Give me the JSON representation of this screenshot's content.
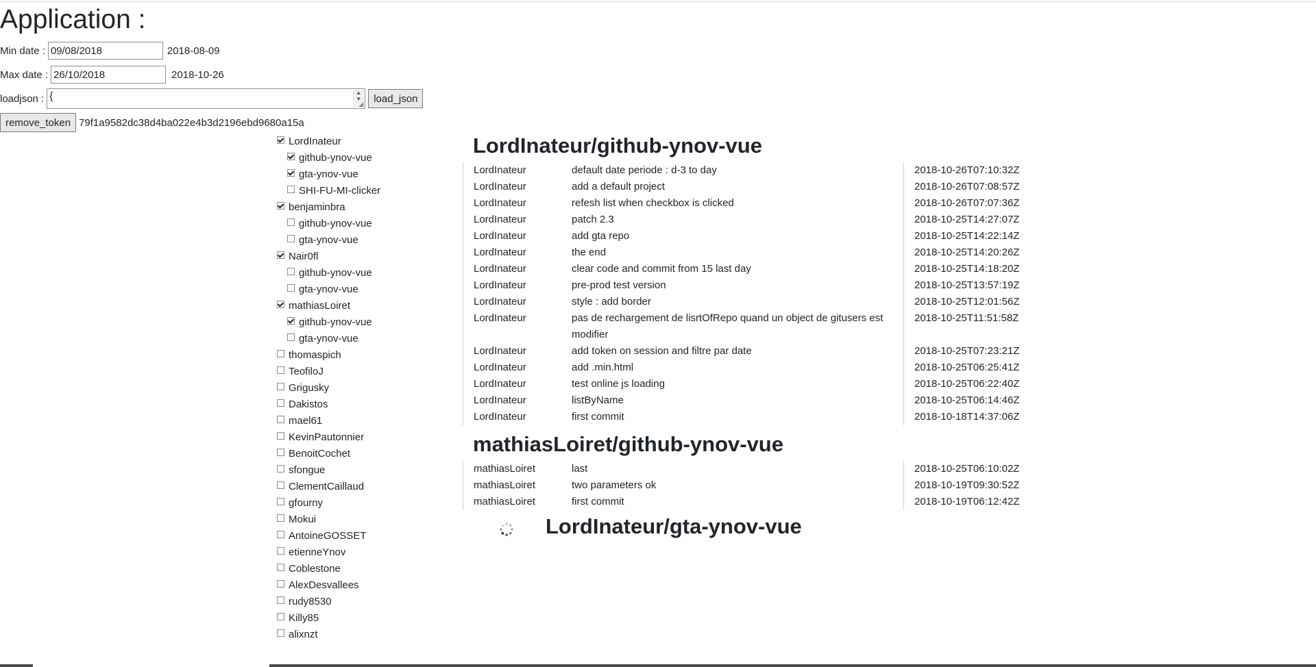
{
  "title": "Application :",
  "filters": {
    "min_label": "Min date :",
    "min_value": "09/08/2018",
    "min_iso": "2018-08-09",
    "max_label": "Max date :",
    "max_value": "26/10/2018",
    "max_iso": "2018-10-26",
    "json_label": "loadjson :",
    "json_value": "{",
    "load_button": "load_json",
    "remove_button": "remove_token",
    "token": "79f1a9582dc38d4ba022e4b3d2196ebd9680a15a"
  },
  "users": [
    {
      "name": "LordInateur",
      "checked": true,
      "repos": [
        {
          "name": "github-ynov-vue",
          "checked": true
        },
        {
          "name": "gta-ynov-vue",
          "checked": true
        },
        {
          "name": "SHI-FU-MI-clicker",
          "checked": false
        }
      ]
    },
    {
      "name": "benjaminbra",
      "checked": true,
      "repos": [
        {
          "name": "github-ynov-vue",
          "checked": false
        },
        {
          "name": "gta-ynov-vue",
          "checked": false
        }
      ]
    },
    {
      "name": "Nair0fl",
      "checked": true,
      "repos": [
        {
          "name": "github-ynov-vue",
          "checked": false
        },
        {
          "name": "gta-ynov-vue",
          "checked": false
        }
      ]
    },
    {
      "name": "mathiasLoiret",
      "checked": true,
      "repos": [
        {
          "name": "github-ynov-vue",
          "checked": true
        },
        {
          "name": "gta-ynov-vue",
          "checked": false
        }
      ]
    },
    {
      "name": "thomaspich",
      "checked": false,
      "repos": []
    },
    {
      "name": "TeofiloJ",
      "checked": false,
      "repos": []
    },
    {
      "name": "Grigusky",
      "checked": false,
      "repos": []
    },
    {
      "name": "Dakistos",
      "checked": false,
      "repos": []
    },
    {
      "name": "mael61",
      "checked": false,
      "repos": []
    },
    {
      "name": "KevinPautonnier",
      "checked": false,
      "repos": []
    },
    {
      "name": "BenoitCochet",
      "checked": false,
      "repos": []
    },
    {
      "name": "sfongue",
      "checked": false,
      "repos": []
    },
    {
      "name": "ClementCaillaud",
      "checked": false,
      "repos": []
    },
    {
      "name": "gfourny",
      "checked": false,
      "repos": []
    },
    {
      "name": "Mokui",
      "checked": false,
      "repos": []
    },
    {
      "name": "AntoineGOSSET",
      "checked": false,
      "repos": []
    },
    {
      "name": "etienneYnov",
      "checked": false,
      "repos": []
    },
    {
      "name": "Coblestone",
      "checked": false,
      "repos": []
    },
    {
      "name": "AlexDesvallees",
      "checked": false,
      "repos": []
    },
    {
      "name": "rudy8530",
      "checked": false,
      "repos": []
    },
    {
      "name": "Killy85",
      "checked": false,
      "repos": []
    },
    {
      "name": "alixnzt",
      "checked": false,
      "repos": []
    }
  ],
  "repos": [
    {
      "title": "LordInateur/github-ynov-vue",
      "commits": [
        {
          "author": "LordInateur",
          "message": "default date periode : d-3 to day",
          "date": "2018-10-26T07:10:32Z"
        },
        {
          "author": "LordInateur",
          "message": "add a default project",
          "date": "2018-10-26T07:08:57Z"
        },
        {
          "author": "LordInateur",
          "message": "refesh list when checkbox is clicked",
          "date": "2018-10-26T07:07:36Z"
        },
        {
          "author": "LordInateur",
          "message": "patch 2.3",
          "date": "2018-10-25T14:27:07Z"
        },
        {
          "author": "LordInateur",
          "message": "add gta repo",
          "date": "2018-10-25T14:22:14Z"
        },
        {
          "author": "LordInateur",
          "message": "the end",
          "date": "2018-10-25T14:20:26Z"
        },
        {
          "author": "LordInateur",
          "message": "clear code and commit from 15 last day",
          "date": "2018-10-25T14:18:20Z"
        },
        {
          "author": "LordInateur",
          "message": "pre-prod test version",
          "date": "2018-10-25T13:57:19Z"
        },
        {
          "author": "LordInateur",
          "message": "style : add border",
          "date": "2018-10-25T12:01:56Z"
        },
        {
          "author": "LordInateur",
          "message": "pas de rechargement de lisrtOfRepo quand un object de gitusers est modifier",
          "date": "2018-10-25T11:51:58Z"
        },
        {
          "author": "LordInateur",
          "message": "add token on session and filtre par date",
          "date": "2018-10-25T07:23:21Z"
        },
        {
          "author": "LordInateur",
          "message": "add .min.html",
          "date": "2018-10-25T06:25:41Z"
        },
        {
          "author": "LordInateur",
          "message": "test online js loading",
          "date": "2018-10-25T06:22:40Z"
        },
        {
          "author": "LordInateur",
          "message": "listByName",
          "date": "2018-10-25T06:14:46Z"
        },
        {
          "author": "LordInateur",
          "message": "first commit",
          "date": "2018-10-18T14:37:06Z"
        }
      ]
    },
    {
      "title": "mathiasLoiret/github-ynov-vue",
      "commits": [
        {
          "author": "mathiasLoiret",
          "message": "last",
          "date": "2018-10-25T06:10:02Z"
        },
        {
          "author": "mathiasLoiret",
          "message": "two parameters ok",
          "date": "2018-10-19T09:30:52Z"
        },
        {
          "author": "mathiasLoiret",
          "message": "first commit",
          "date": "2018-10-19T06:12:42Z"
        }
      ]
    }
  ],
  "loading_repo": {
    "title": "LordInateur/gta-ynov-vue"
  },
  "colors": {
    "text": "#212529",
    "border": "#d0d0d0",
    "button_bg": "#e8e8e8"
  }
}
